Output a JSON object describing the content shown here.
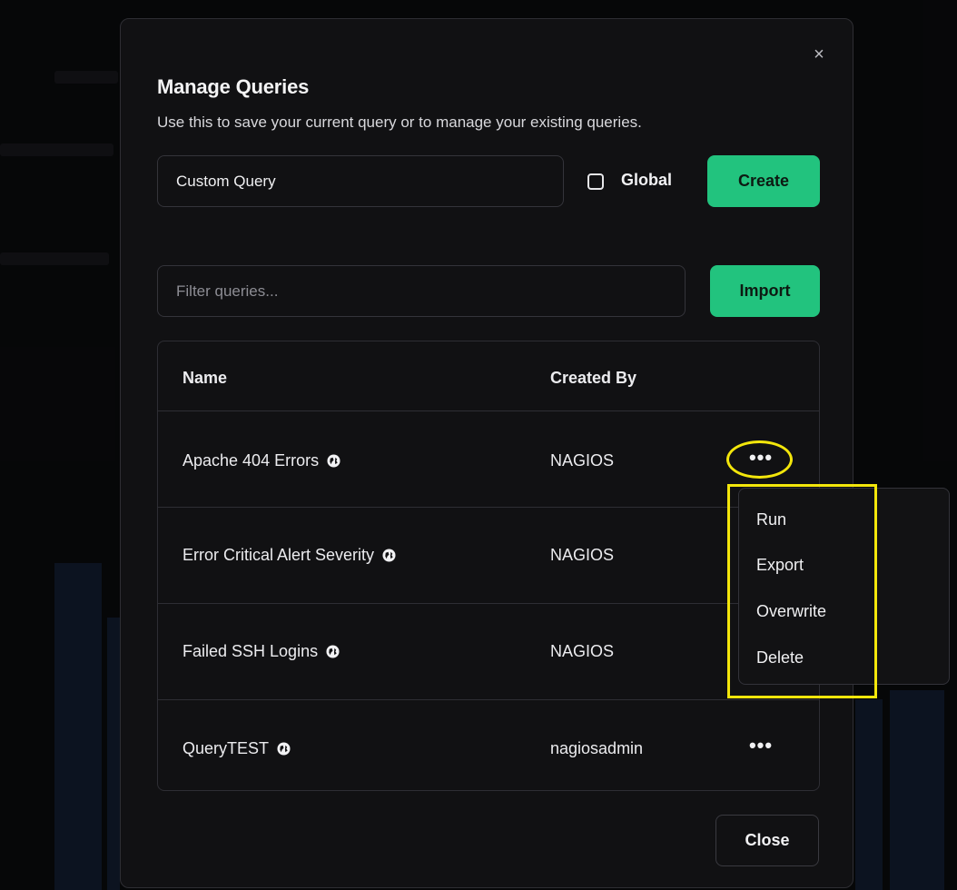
{
  "modal": {
    "title": "Manage Queries",
    "subtitle": "Use this to save your current query or to manage your existing queries.",
    "close_icon": "×"
  },
  "create_form": {
    "query_name_value": "Custom Query",
    "global_label": "Global",
    "global_checked": false,
    "create_label": "Create"
  },
  "filter": {
    "placeholder": "Filter queries...",
    "import_label": "Import"
  },
  "table": {
    "columns": [
      "Name",
      "Created By"
    ],
    "rows": [
      {
        "name": "Apache 404 Errors",
        "created_by": "NAGIOS",
        "global": true
      },
      {
        "name": "Error Critical Alert Severity",
        "created_by": "NAGIOS",
        "global": true
      },
      {
        "name": "Failed SSH Logins",
        "created_by": "NAGIOS",
        "global": true
      },
      {
        "name": "QueryTEST",
        "created_by": "nagiosadmin",
        "global": true
      }
    ],
    "actions_label": "•••"
  },
  "actions_menu": {
    "items": [
      "Run",
      "Export",
      "Overwrite",
      "Delete"
    ]
  },
  "footer": {
    "close_label": "Close"
  },
  "colors": {
    "accent": "#22c37e",
    "highlight": "#f3e60b",
    "modal_bg": "#111113",
    "border": "#2e2e34"
  },
  "icons": {
    "global": "globe-icon",
    "close": "close-icon",
    "actions": "more-horizontal-icon"
  }
}
